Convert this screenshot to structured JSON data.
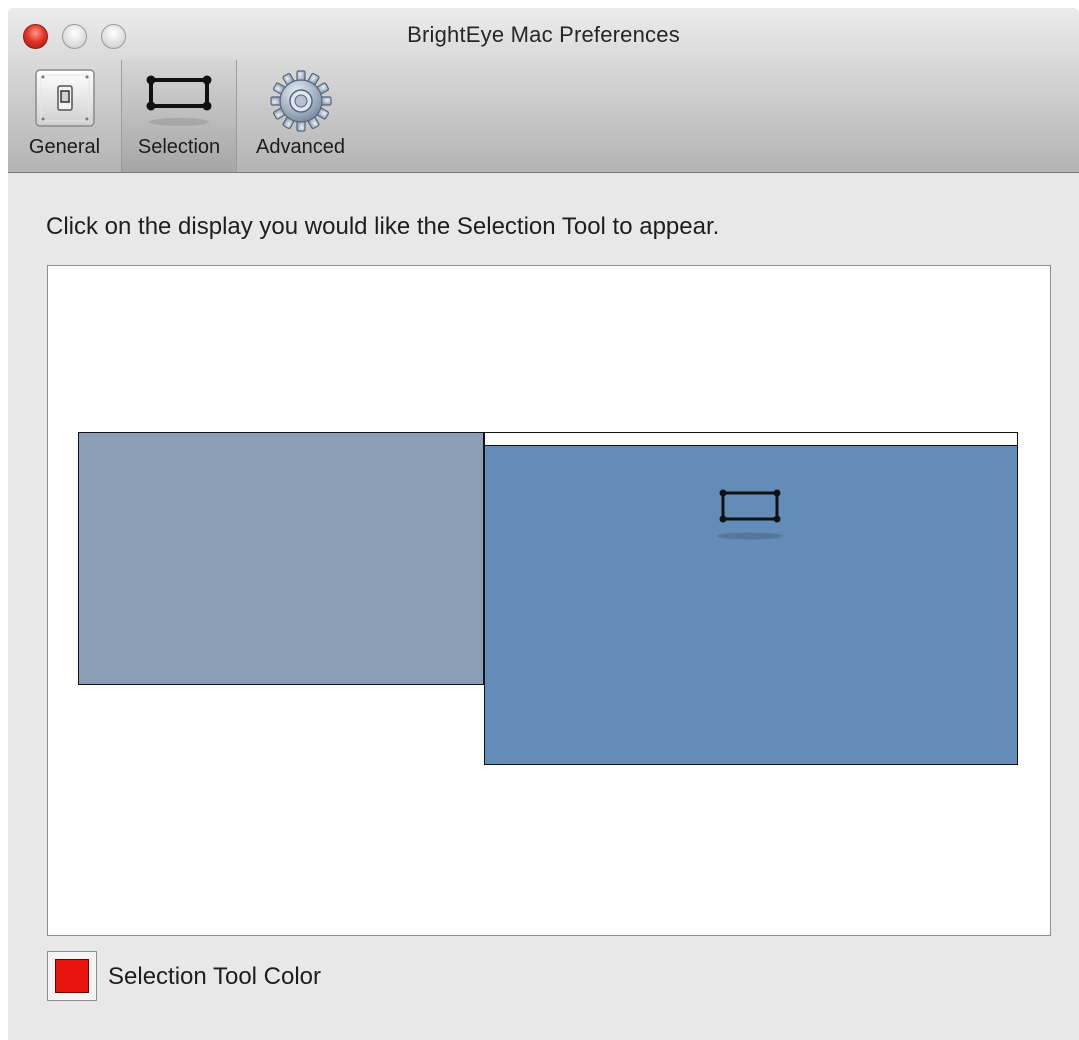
{
  "window": {
    "title": "BrightEye Mac Preferences"
  },
  "toolbar": {
    "items": [
      {
        "label": "General",
        "icon": "light-switch-icon",
        "selected": false
      },
      {
        "label": "Selection",
        "icon": "selection-rectangle-icon",
        "selected": true
      },
      {
        "label": "Advanced",
        "icon": "gear-icon",
        "selected": false
      }
    ]
  },
  "content": {
    "instruction": "Click on the display you would like the Selection Tool to appear.",
    "displays": [
      {
        "name": "display-1",
        "active": false,
        "color": "#8a9fb5"
      },
      {
        "name": "display-2",
        "active": true,
        "color": "#638db8",
        "has_menubar": true,
        "shows_selection_tool": true
      }
    ],
    "selection_tool_color": {
      "label": "Selection Tool Color",
      "value": "#e8120c"
    }
  }
}
